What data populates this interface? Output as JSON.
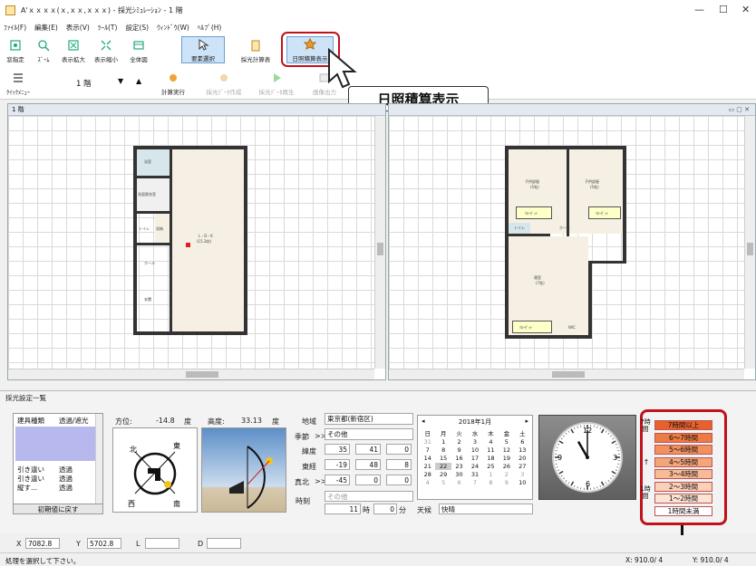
{
  "window": {
    "title": "A'ｘｘｘｘ(ｘ,ｘｘ,ｘｘｘ) - 採光ｼﾐｭﾚｰｼｮﾝ - 1 階",
    "minimize": "—",
    "maximize": "☐",
    "close": "✕"
  },
  "menu": [
    "ﾌｧｲﾙ(F)",
    "編集(E)",
    "表示(V)",
    "ﾂｰﾙ(T)",
    "設定(S)",
    "ｳｨﾝﾄﾞｳ(W)",
    "ﾍﾙﾌﾟ(H)"
  ],
  "toolbar": {
    "row1": [
      "窓指定",
      "ｽﾞｰﾑ",
      "表示拡大",
      "表示縮小",
      "全体図",
      "要素選択",
      "採光計算表",
      "日照積算表示"
    ],
    "quick_menu": "ｸｲｯｸﾒﾆｭｰ",
    "floor": "1 階",
    "row2": [
      "計算実行",
      "採光ﾃﾞｰﾀ作成",
      "採光ﾃﾞｰﾀ再生",
      "画像出力"
    ]
  },
  "callout": "日照積算表示",
  "left_pane": {
    "title": "1 階",
    "rooms": [
      "浴室",
      "洗面脱衣室",
      "トイレ",
      "収納",
      "ホール",
      "玄関",
      "L・D・K",
      "(15.3帖)"
    ]
  },
  "right_pane": {
    "rooms": [
      "子供部屋",
      "(5帖)",
      "子供部屋",
      "(5帖)",
      "ｸﾛｰｾﾞｯﾄ",
      "ｸﾛｰｾﾞｯﾄ",
      "トイレ",
      "ホール",
      "寝室",
      "(7帖)",
      "ｸﾛｰｾﾞｯﾄ",
      "WIC"
    ]
  },
  "panel": {
    "title": "採光設定一覧",
    "table": {
      "headers": [
        "建具種類",
        "透過/遮光"
      ],
      "rows": [
        [
          "引き違い",
          "透過"
        ],
        [
          "引き違い",
          "透過"
        ],
        [
          "縦す...",
          "透過"
        ]
      ]
    },
    "reset": "初期値に戻す",
    "azimuth_label": "方位:",
    "azimuth_value": "-14.8",
    "azimuth_unit": "度",
    "altitude_label": "高度:",
    "altitude_value": "33.13",
    "altitude_unit": "度",
    "compass": {
      "north": "北",
      "east": "東",
      "west": "西",
      "south": "南"
    },
    "region_label": "地域",
    "region_value": "東京都(新宿区)",
    "season_label": "季節",
    "season_value": "その他",
    "lat_label": "緯度",
    "lat": [
      "35",
      "41",
      "0"
    ],
    "lon_label": "東経",
    "lon": [
      "-19",
      "48",
      "8"
    ],
    "north_label": "真北",
    "north": [
      "-45",
      "0",
      "0"
    ],
    "time_label": "時刻",
    "time_select": "その他",
    "time_hour": "11",
    "hour_unit": "時",
    "time_min": "0",
    "min_unit": "分",
    "weather_label": "天候",
    "weather_value": "快晴",
    "calendar": {
      "title": "2018年1月",
      "weekdays": [
        "日",
        "月",
        "火",
        "水",
        "木",
        "金",
        "土"
      ],
      "rows": [
        [
          "31",
          "1",
          "2",
          "3",
          "4",
          "5",
          "6"
        ],
        [
          "7",
          "8",
          "9",
          "10",
          "11",
          "12",
          "13"
        ],
        [
          "14",
          "15",
          "16",
          "17",
          "18",
          "19",
          "20"
        ],
        [
          "21",
          "22",
          "23",
          "24",
          "25",
          "26",
          "27"
        ],
        [
          "28",
          "29",
          "30",
          "31",
          "1",
          "2",
          "3"
        ],
        [
          "4",
          "5",
          "6",
          "7",
          "8",
          "9",
          "10"
        ]
      ],
      "selected": "22"
    },
    "clock": {
      "hour": 11,
      "minute": 0,
      "labels": [
        "12",
        "3",
        "6",
        "9"
      ]
    },
    "legend_side": [
      "7時間",
      "↑",
      "1時間"
    ],
    "legend": [
      {
        "label": "7時間以上",
        "color": "#e8612c"
      },
      {
        "label": "6〜7時間",
        "color": "#ee7a44"
      },
      {
        "label": "5〜6時間",
        "color": "#f2915e"
      },
      {
        "label": "4〜5時間",
        "color": "#f5a679"
      },
      {
        "label": "3〜4時間",
        "color": "#f8bb96"
      },
      {
        "label": "2〜3時間",
        "color": "#fbd0b6"
      },
      {
        "label": "1〜2時間",
        "color": "#fde3d3"
      },
      {
        "label": "1時間未満",
        "color": "#ffffff"
      }
    ]
  },
  "status": {
    "x_label": "X",
    "x": "7082.8",
    "y_label": "Y",
    "y": "5702.8",
    "l_label": "L",
    "d_label": "D",
    "message": "処理を選択して下さい。",
    "coord_x": "X: 910.0/ 4",
    "coord_y": "Y: 910.0/ 4"
  },
  "accent": "#c0121b"
}
